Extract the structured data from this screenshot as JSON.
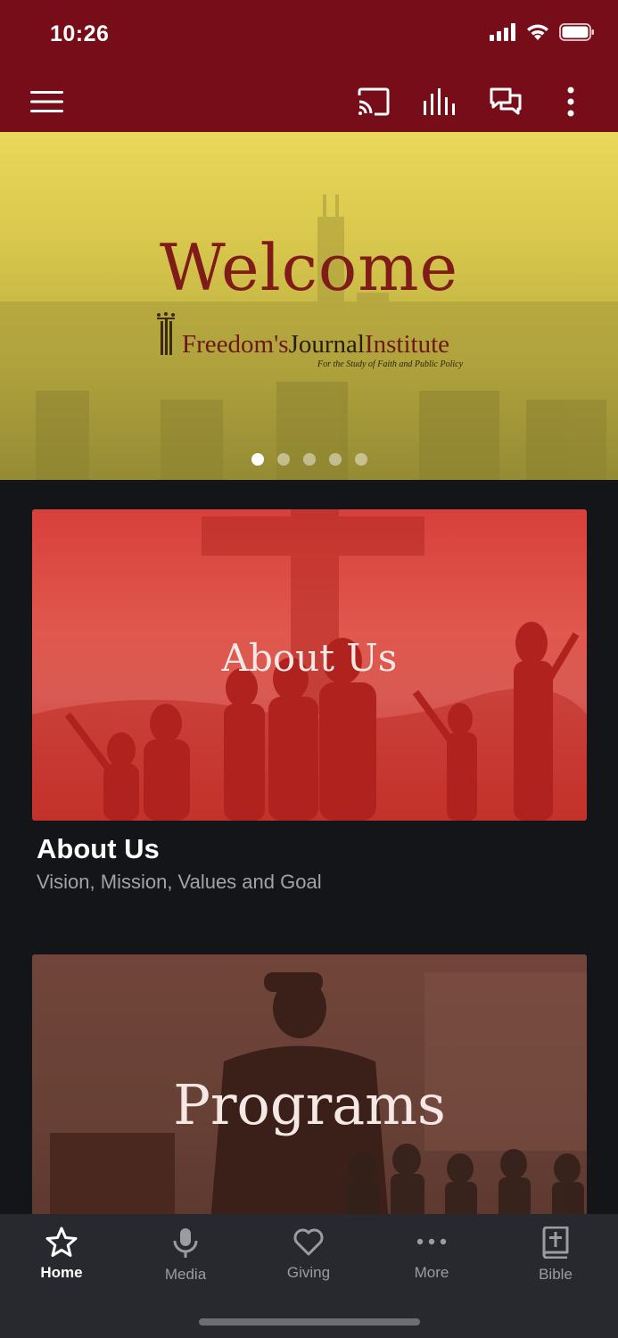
{
  "status_bar": {
    "time": "10:26"
  },
  "toolbar": {
    "icons": [
      "menu-icon",
      "cast-icon",
      "equalizer-icon",
      "chat-icon",
      "more-vertical-icon"
    ]
  },
  "hero": {
    "title": "Welcome",
    "logo_name_part1": "Freedom's",
    "logo_name_part2": "Journal",
    "logo_name_part3": "Institute",
    "tagline": "For the Study of Faith and Public Policy",
    "slide_count": 5,
    "active_slide": 1
  },
  "cards": [
    {
      "image_title": "About Us",
      "title": "About Us",
      "subtitle": "Vision, Mission, Values and Goal"
    },
    {
      "image_title": "Programs"
    }
  ],
  "tabs": [
    {
      "label": "Home",
      "icon": "star-icon",
      "active": true
    },
    {
      "label": "Media",
      "icon": "microphone-icon",
      "active": false
    },
    {
      "label": "Giving",
      "icon": "heart-icon",
      "active": false
    },
    {
      "label": "More",
      "icon": "ellipsis-icon",
      "active": false
    },
    {
      "label": "Bible",
      "icon": "bible-icon",
      "active": false
    }
  ],
  "colors": {
    "brand": "#760d18",
    "background": "#141518",
    "tabbar": "#28292e"
  }
}
